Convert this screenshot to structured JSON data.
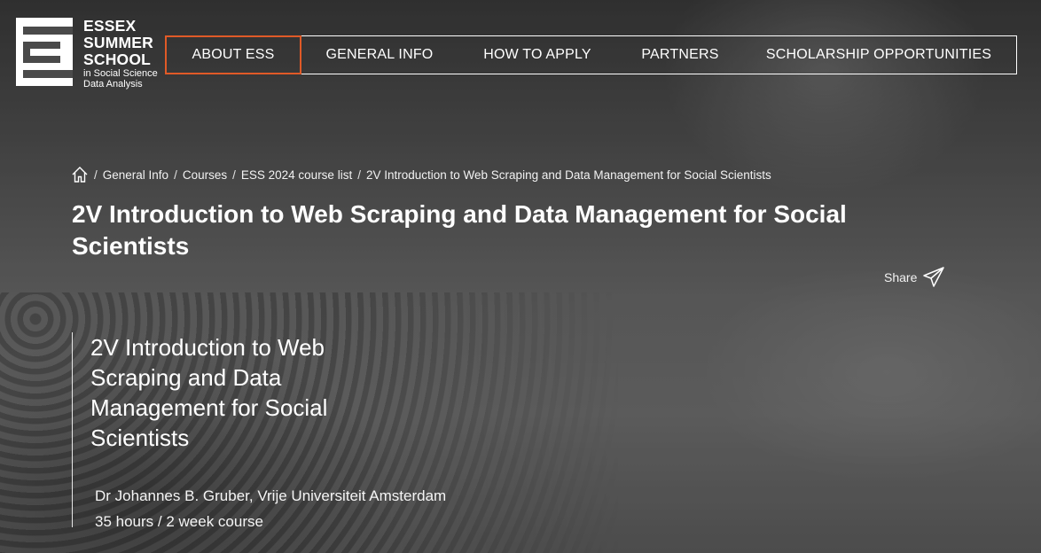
{
  "logo": {
    "line1": "ESSEX",
    "line2": "SUMMER",
    "line3": "SCHOOL",
    "line4": "in Social Science",
    "line5": "Data Analysis"
  },
  "nav": {
    "items": [
      {
        "label": "ABOUT ESS",
        "active": true
      },
      {
        "label": "GENERAL INFO",
        "active": false
      },
      {
        "label": "HOW TO APPLY",
        "active": false
      },
      {
        "label": "PARTNERS",
        "active": false
      },
      {
        "label": "SCHOLARSHIP OPPORTUNITIES",
        "active": false
      }
    ]
  },
  "breadcrumb": {
    "home_icon": "home-icon",
    "items": [
      "General Info",
      "Courses",
      "ESS 2024 course list",
      "2V Introduction to Web Scraping and Data Management for Social Scientists"
    ]
  },
  "page": {
    "title": "2V Introduction to Web Scraping and Data Management for Social Scientists"
  },
  "share": {
    "label": "Share",
    "icon": "paper-plane-icon"
  },
  "course": {
    "title": "2V Introduction to Web Scraping and Data Management for Social Scientists",
    "instructor": "Dr Johannes B. Gruber, Vrije Universiteit Amsterdam",
    "duration": "35 hours / 2 week course"
  },
  "colors": {
    "accent": "#e05a27",
    "text": "#ffffff"
  }
}
